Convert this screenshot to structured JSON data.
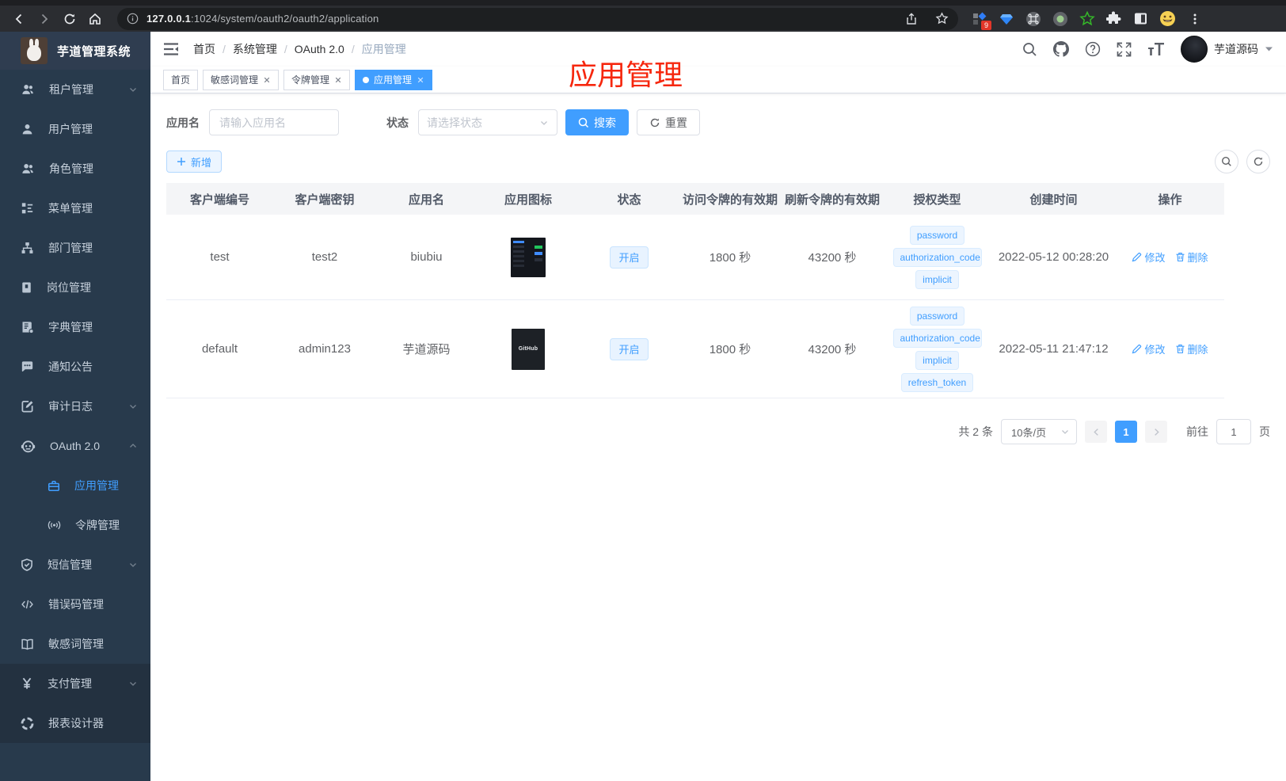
{
  "browser": {
    "url_host": "127.0.0.1",
    "url_rest": ":1024/system/oauth2/oauth2/application",
    "extension_badge": "9"
  },
  "sidebar": {
    "logo_title": "芋道管理系统",
    "items": [
      {
        "label": "租户管理",
        "icon": "users-icon"
      },
      {
        "label": "用户管理",
        "icon": "user-icon"
      },
      {
        "label": "角色管理",
        "icon": "roles-icon"
      },
      {
        "label": "菜单管理",
        "icon": "menu-tree-icon"
      },
      {
        "label": "部门管理",
        "icon": "org-chart-icon"
      },
      {
        "label": "岗位管理",
        "icon": "post-badge-icon"
      },
      {
        "label": "字典管理",
        "icon": "dictionary-icon"
      },
      {
        "label": "通知公告",
        "icon": "notice-icon"
      },
      {
        "label": "审计日志",
        "icon": "audit-log-icon"
      },
      {
        "label": "OAuth 2.0",
        "icon": "oauth-robot-icon"
      },
      {
        "label": "应用管理",
        "icon": "briefcase-icon"
      },
      {
        "label": "令牌管理",
        "icon": "token-signal-icon"
      },
      {
        "label": "短信管理",
        "icon": "shield-icon"
      },
      {
        "label": "错误码管理",
        "icon": "code-icon"
      },
      {
        "label": "敏感词管理",
        "icon": "open-book-icon"
      },
      {
        "label": "支付管理",
        "icon": "yen-icon"
      },
      {
        "label": "报表设计器",
        "icon": "report-wheel-icon"
      }
    ]
  },
  "header": {
    "breadcrumb": [
      "首页",
      "系统管理",
      "OAuth 2.0",
      "应用管理"
    ],
    "separator": "/",
    "user_name": "芋道源码"
  },
  "tags_view": [
    {
      "label": "首页"
    },
    {
      "label": "敏感词管理"
    },
    {
      "label": "令牌管理"
    },
    {
      "label": "应用管理"
    }
  ],
  "annotation": "应用管理",
  "filter": {
    "app_name_label": "应用名",
    "app_name_placeholder": "请输入应用名",
    "status_label": "状态",
    "status_placeholder": "请选择状态",
    "search_label": "搜索",
    "reset_label": "重置",
    "add_label": "新增"
  },
  "table": {
    "columns": [
      "客户端编号",
      "客户端密钥",
      "应用名",
      "应用图标",
      "状态",
      "访问令牌的有效期",
      "刷新令牌的有效期",
      "授权类型",
      "创建时间",
      "操作"
    ],
    "edit_label": "修改",
    "delete_label": "删除",
    "rows": [
      {
        "client_id": "test",
        "client_secret": "test2",
        "app_name": "biubiu",
        "status": "开启",
        "access_token_validity": "1800 秒",
        "refresh_token_validity": "43200 秒",
        "grants": [
          "password",
          "authorization_code",
          "implicit"
        ],
        "created_at": "2022-05-12 00:28:20",
        "icon_text": ""
      },
      {
        "client_id": "default",
        "client_secret": "admin123",
        "app_name": "芋道源码",
        "status": "开启",
        "access_token_validity": "1800 秒",
        "refresh_token_validity": "43200 秒",
        "grants": [
          "password",
          "authorization_code",
          "implicit",
          "refresh_token"
        ],
        "created_at": "2022-05-11 21:47:12",
        "icon_text": "GitHub"
      }
    ]
  },
  "pagination": {
    "total_label": "共 2 条",
    "page_size_label": "10条/页",
    "current_page": "1",
    "goto_label": "前往",
    "goto_value": "1",
    "page_unit_label": "页"
  }
}
